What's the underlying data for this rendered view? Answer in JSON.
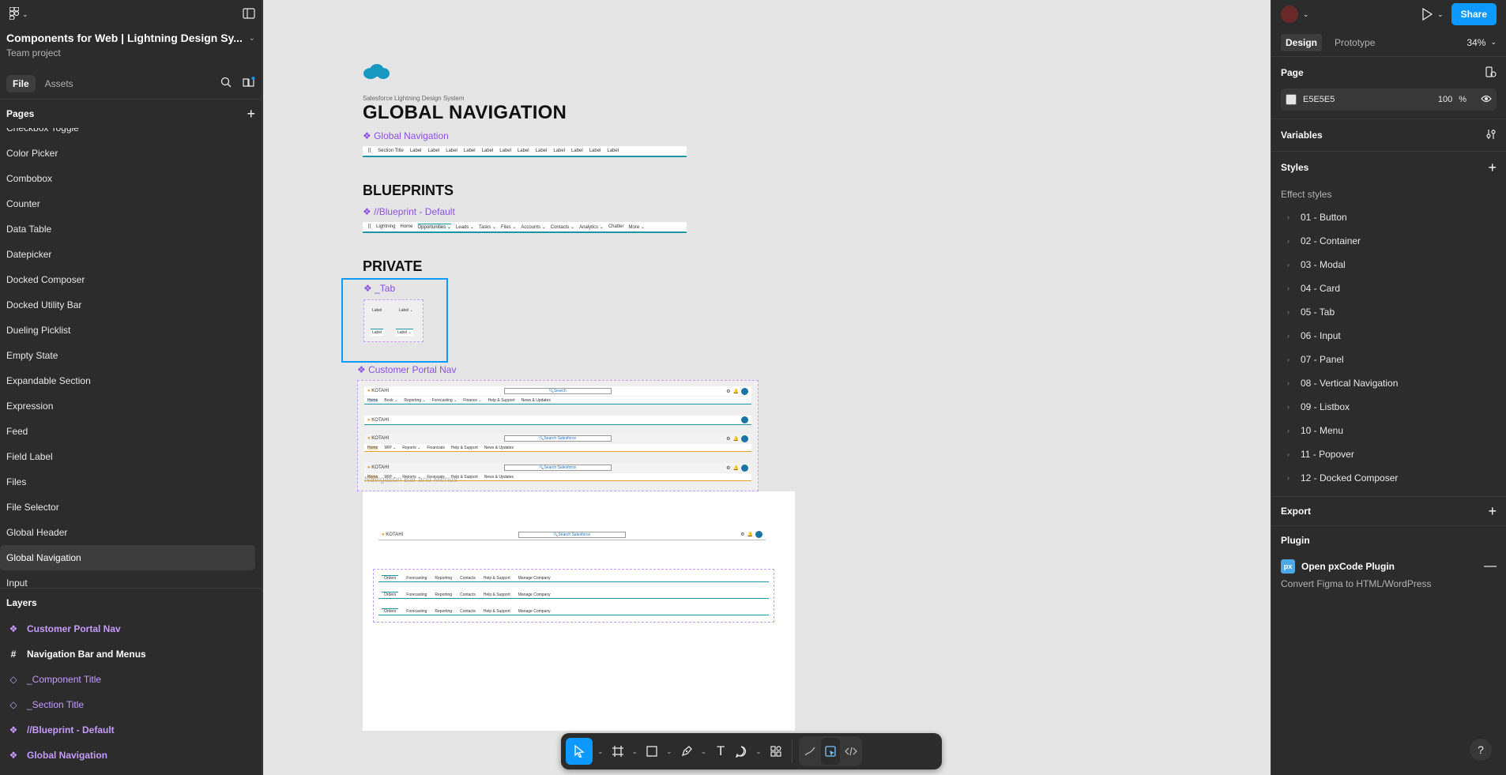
{
  "file": {
    "title": "Components for Web | Lightning Design Sy...",
    "subtitle": "Team project"
  },
  "left_tabs": [
    "File",
    "Assets"
  ],
  "pages": {
    "header": "Pages",
    "items": [
      "Checkbox Toggle",
      "Color Picker",
      "Combobox",
      "Counter",
      "Data Table",
      "Datepicker",
      "Docked Composer",
      "Docked Utility Bar",
      "Dueling Picklist",
      "Empty State",
      "Expandable Section",
      "Expression",
      "Feed",
      "Field Label",
      "Files",
      "File Selector",
      "Global Header",
      "Global Navigation",
      "Input"
    ],
    "selected": "Global Navigation"
  },
  "layers": {
    "header": "Layers",
    "items": [
      {
        "name": "Customer Portal Nav",
        "kind": "component"
      },
      {
        "name": "Navigation Bar and Menus",
        "kind": "frame"
      },
      {
        "name": "_Component Title",
        "kind": "instance"
      },
      {
        "name": "_Section Title",
        "kind": "instance"
      },
      {
        "name": "//Blueprint - Default",
        "kind": "component"
      },
      {
        "name": "Global Navigation",
        "kind": "component"
      }
    ]
  },
  "canvas": {
    "caption": "Salesforce Lightning Design System",
    "main_title": "GLOBAL NAVIGATION",
    "comp_global_nav": "❖ Global Navigation",
    "strip1": {
      "title": "Section Title",
      "labels": [
        "Label",
        "Label",
        "Label",
        "Label",
        "Label",
        "Label",
        "Label",
        "Label",
        "Label",
        "Label",
        "Label",
        "Label"
      ]
    },
    "blueprints_title": "BLUEPRINTS",
    "comp_blueprint": "❖ //Blueprint - Default",
    "strip2": {
      "title": "Lightning",
      "labels": [
        "Home",
        "Opportunities ⌄",
        "Leads ⌄",
        "Tasks ⌄",
        "Files ⌄",
        "Accounts ⌄",
        "Contacts ⌄",
        "Analytics ⌄",
        "Chatter",
        "More ⌄"
      ]
    },
    "private_title": "PRIVATE",
    "comp_tab": "❖ _Tab",
    "tab_labels": [
      "Label",
      "Label ⌄",
      "Label",
      "Label ⌄"
    ],
    "comp_portal": "❖ Customer Portal Nav",
    "portal_brand": "KOTAHI",
    "portal_search_1": "Search",
    "portal_search_2": "Search Salesforce",
    "portal_nav_1": [
      "Home",
      "Book ⌄",
      "Reporting ⌄",
      "Forecasting ⌄",
      "Finance ⌄",
      "Help & Support",
      "News & Updates"
    ],
    "portal_nav_2": [
      "Home",
      "WIP ⌄",
      "Reports ⌄",
      "Financials",
      "Help & Support",
      "News & Updates"
    ],
    "nav_bar_title": "Navigation Bar and Menus",
    "menus_nav": [
      "Orders",
      "Forecasting",
      "Reporting",
      "Contacts",
      "Help & Support",
      "Manage Company"
    ]
  },
  "toolbar": {
    "tools": [
      "move-tool",
      "frame-tool",
      "shape-tool",
      "pen-tool",
      "text-tool",
      "comment-tool",
      "actions-tool"
    ],
    "text_tool_label": "T"
  },
  "right": {
    "tabs": [
      "Design",
      "Prototype"
    ],
    "zoom": "34%",
    "share": "Share",
    "page_header": "Page",
    "page_color": "E5E5E5",
    "page_opacity": "100",
    "percent_sign": "%",
    "variables": "Variables",
    "styles": "Styles",
    "effect_styles": "Effect styles",
    "effects": [
      "01 - Button",
      "02 - Container",
      "03 - Modal",
      "04 - Card",
      "05 - Tab",
      "06 - Input",
      "07 - Panel",
      "08 - Vertical Navigation",
      "09 - Listbox",
      "10 - Menu",
      "11 - Popover",
      "12 - Docked Composer"
    ],
    "export": "Export",
    "plugin": "Plugin",
    "plugin_name": "Open pxCode Plugin",
    "plugin_badge": "px",
    "plugin_desc": "Convert Figma to HTML/WordPress",
    "help": "?"
  },
  "colors": {
    "accent": "#0d99ff",
    "component": "#c79bff",
    "canvas": "#e5e5e5"
  }
}
